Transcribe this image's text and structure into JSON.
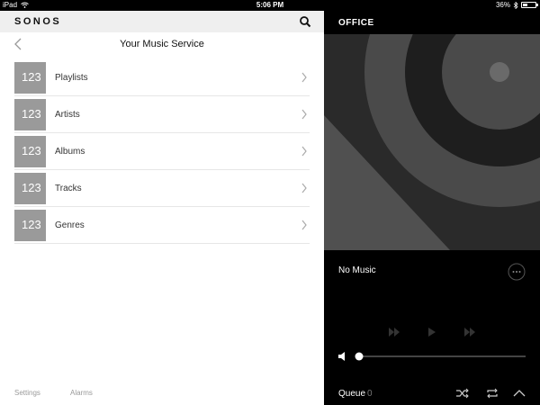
{
  "status_bar": {
    "device": "iPad",
    "time": "5:06 PM",
    "battery": "36%",
    "battery_level": 0.36
  },
  "app": {
    "brand": "SONOS"
  },
  "page": {
    "title": "Your Music Service"
  },
  "browse_items": [
    {
      "label": "Playlists",
      "thumb_text": "123"
    },
    {
      "label": "Artists",
      "thumb_text": "123"
    },
    {
      "label": "Albums",
      "thumb_text": "123"
    },
    {
      "label": "Tracks",
      "thumb_text": "123"
    },
    {
      "label": "Genres",
      "thumb_text": "123"
    }
  ],
  "bottom_tabs": {
    "settings": "Settings",
    "alarms": "Alarms"
  },
  "now_playing": {
    "room": "OFFICE",
    "track": "No Music",
    "volume_level": 0.0,
    "queue_label": "Queue",
    "queue_count": "0"
  },
  "icons": {
    "search": "search-icon",
    "back": "chevron-left-icon",
    "chevron": "chevron-right-icon",
    "wifi": "wifi-icon",
    "bluetooth": "bluetooth-icon",
    "more": "more-icon",
    "prev": "previous-icon",
    "play": "play-icon",
    "next": "next-icon",
    "volume": "speaker-icon",
    "shuffle": "shuffle-icon",
    "repeat": "repeat-icon",
    "expand": "chevron-up-icon"
  },
  "colors": {
    "pane_bg": "#ffffff",
    "player_bg": "#000000",
    "thumb_bg": "#9a9a9a",
    "art_dark": "#2a2a2a",
    "art_light": "#505050"
  }
}
